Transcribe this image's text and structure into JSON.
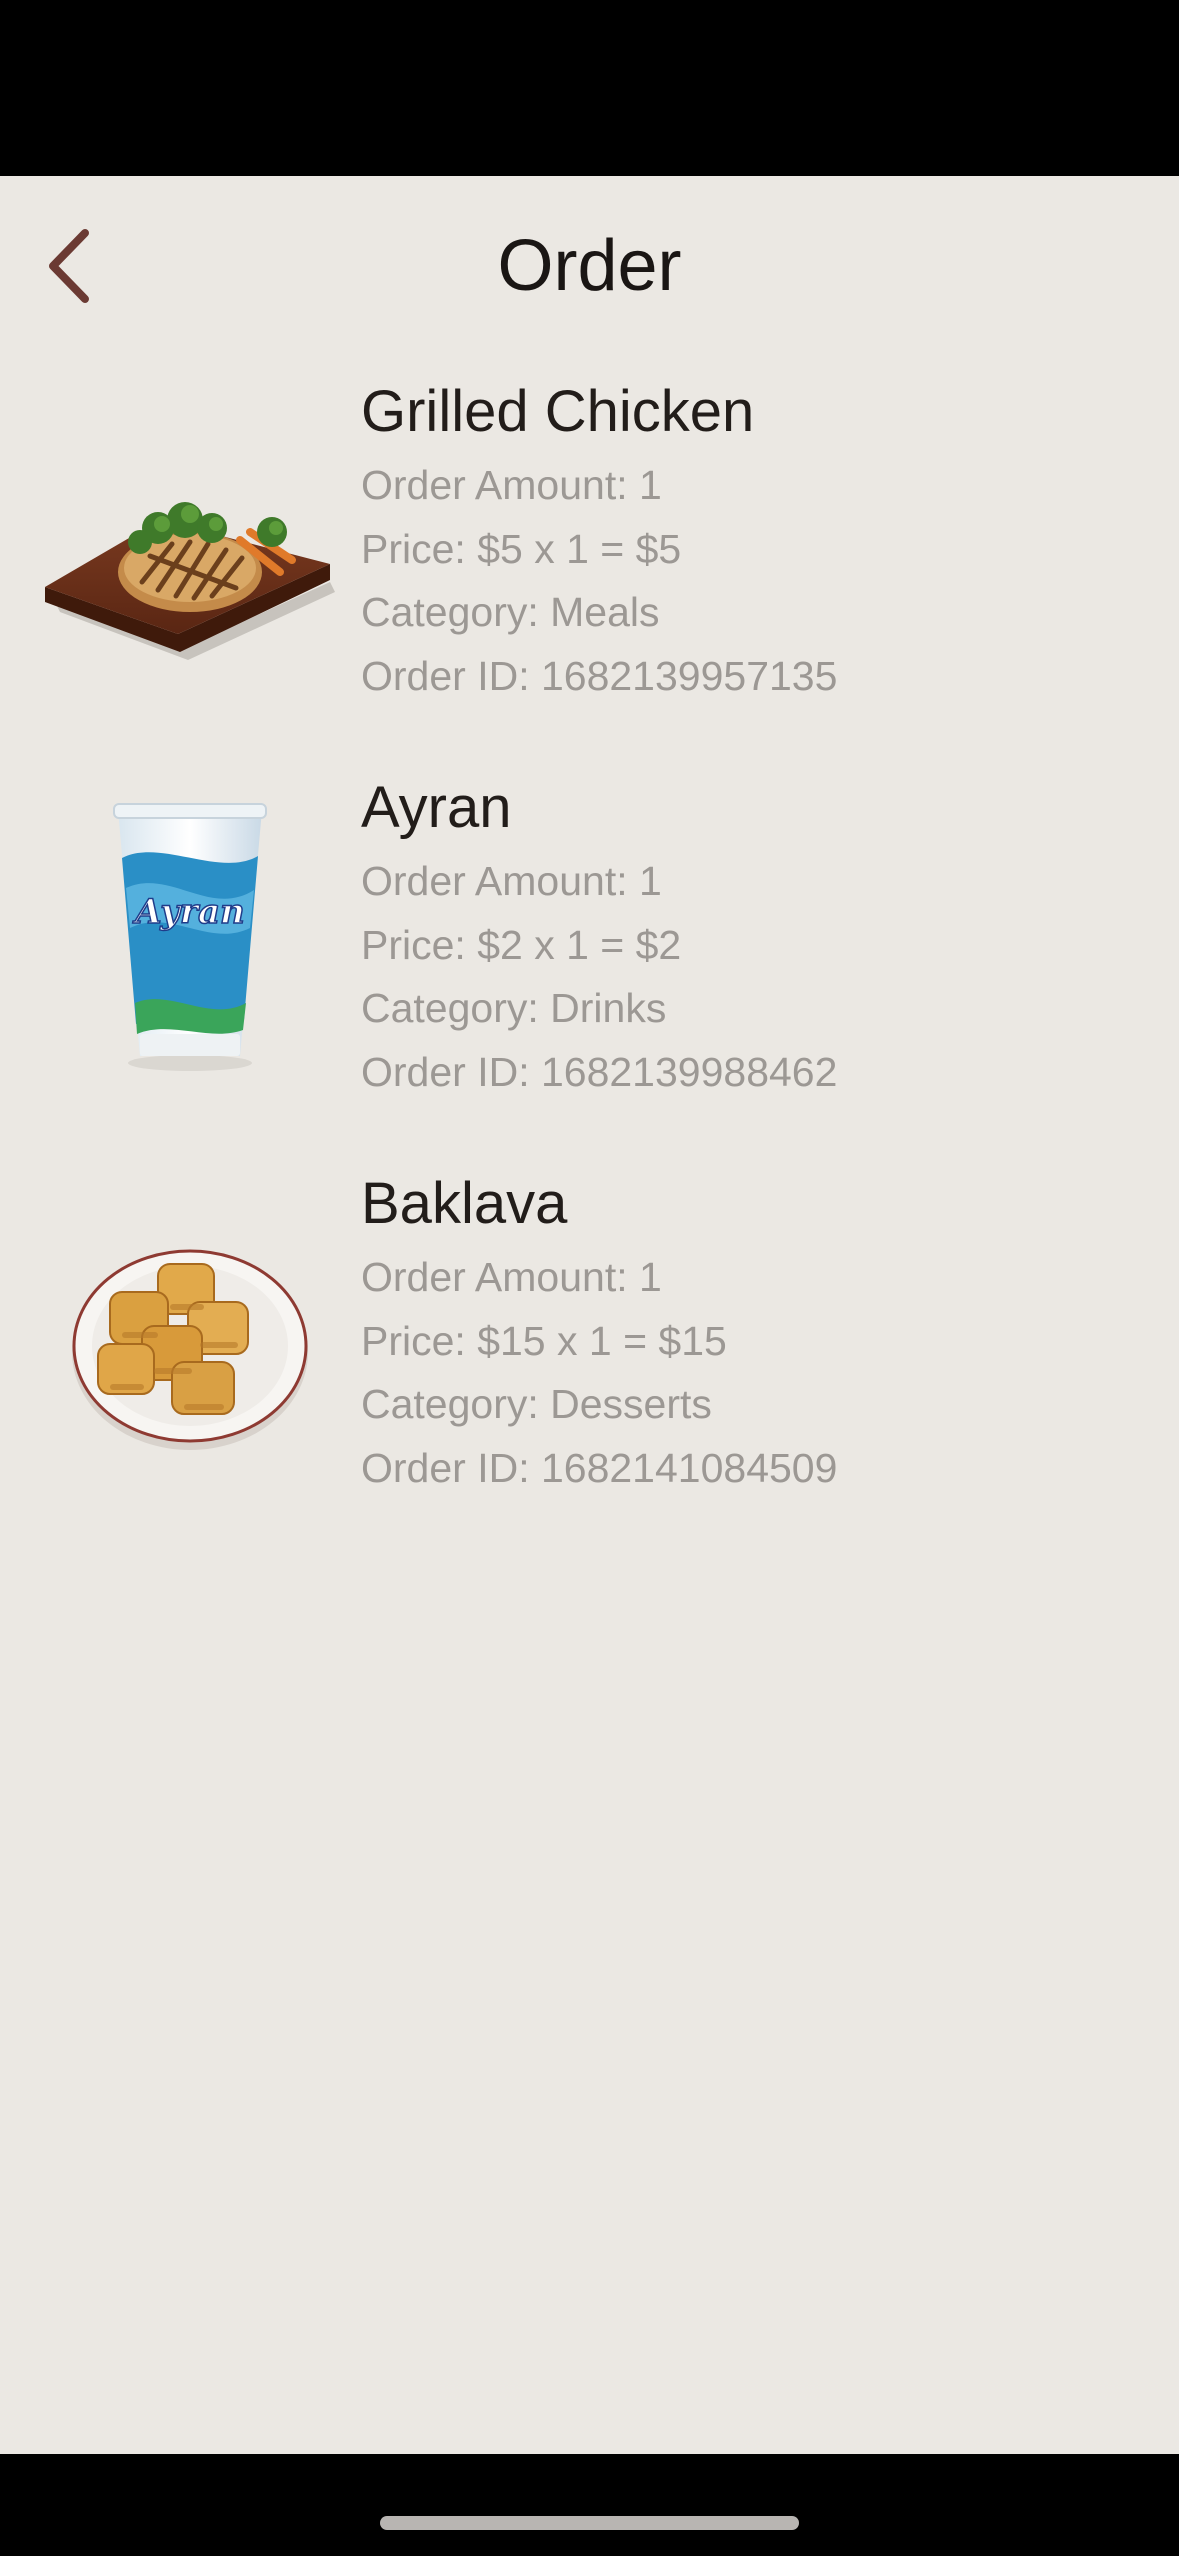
{
  "header": {
    "title": "Order"
  },
  "orders": [
    {
      "name": "Grilled Chicken",
      "amount": "Order Amount: 1",
      "price": "Price: $5 x 1 = $5",
      "category": "Category: Meals",
      "order_id": "Order ID: 1682139957135",
      "image_icon": "grilled-chicken-image"
    },
    {
      "name": "Ayran",
      "amount": "Order Amount: 1",
      "price": "Price: $2 x 1 = $2",
      "category": "Category: Drinks",
      "order_id": "Order ID: 1682139988462",
      "image_icon": "ayran-cup-image",
      "image_logo_text": "Ayran"
    },
    {
      "name": "Baklava",
      "amount": "Order Amount: 1",
      "price": "Price: $15 x 1 = $15",
      "category": "Category: Desserts",
      "order_id": "Order ID: 1682141084509",
      "image_icon": "baklava-plate-image"
    }
  ],
  "colors": {
    "background": "#ebe8e3",
    "accent": "#6b3a33",
    "title_text": "#1a1614",
    "secondary_text": "#9c9894"
  }
}
